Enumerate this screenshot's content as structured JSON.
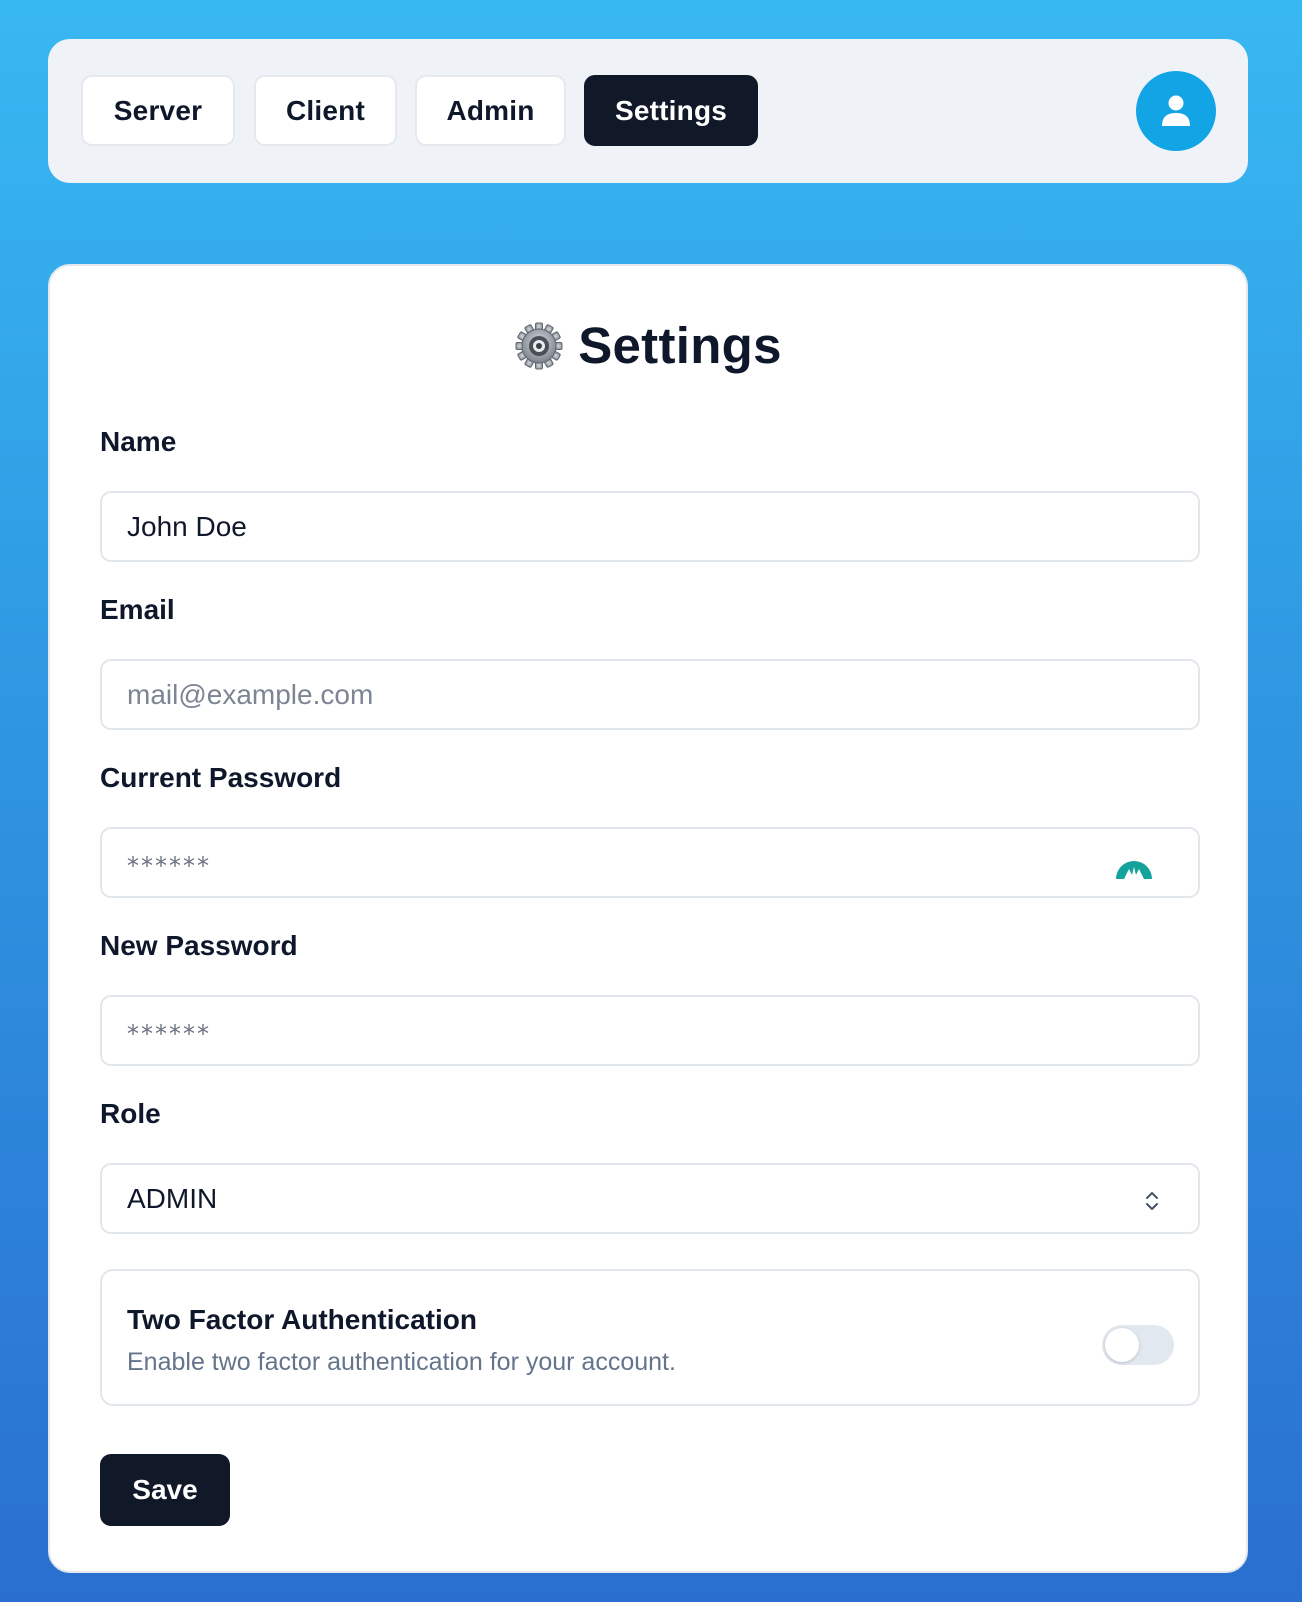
{
  "nav": {
    "tabs": [
      {
        "label": "Server",
        "active": false
      },
      {
        "label": "Client",
        "active": false
      },
      {
        "label": "Admin",
        "active": false
      },
      {
        "label": "Settings",
        "active": true
      }
    ],
    "avatar_icon": "user-icon"
  },
  "settings": {
    "title": "Settings",
    "title_icon": "gear-icon",
    "fields": {
      "name": {
        "label": "Name",
        "value": "John Doe",
        "placeholder": ""
      },
      "email": {
        "label": "Email",
        "value": "",
        "placeholder": "mail@example.com"
      },
      "current_password": {
        "label": "Current Password",
        "masked": "******",
        "icon": "password-manager-icon"
      },
      "new_password": {
        "label": "New Password",
        "masked": "******"
      },
      "role": {
        "label": "Role",
        "selected": "ADMIN"
      }
    },
    "two_factor": {
      "title": "Two Factor Authentication",
      "description": "Enable two factor authentication for your account.",
      "enabled": false
    },
    "save_label": "Save"
  },
  "colors": {
    "accent": "#13a4e6",
    "dark": "#111827",
    "password_icon": "#14a39b"
  }
}
